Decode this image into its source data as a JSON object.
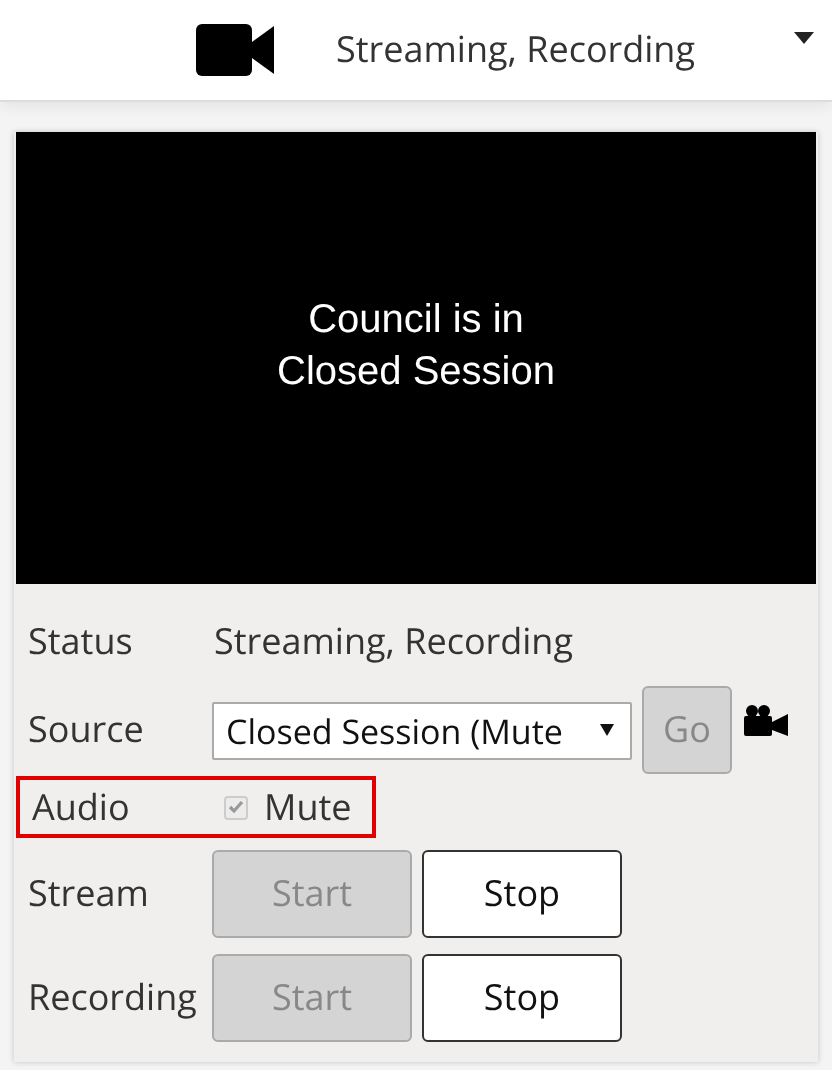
{
  "header": {
    "status": "Streaming, Recording"
  },
  "video": {
    "lines": [
      "Council is in",
      "Closed Session"
    ]
  },
  "controls": {
    "status": {
      "label": "Status",
      "value": "Streaming, Recording"
    },
    "source": {
      "label": "Source",
      "value": "Closed Session (Mute",
      "go": {
        "label": "Go",
        "disabled": true
      }
    },
    "audio": {
      "label": "Audio",
      "highlighted": true,
      "mute": {
        "label": "Mute",
        "checked": true,
        "disabled": true
      }
    },
    "actions": [
      {
        "label": "Stream",
        "buttons": [
          {
            "label": "Start",
            "disabled": true
          },
          {
            "label": "Stop",
            "disabled": false
          }
        ]
      },
      {
        "label": "Recording",
        "buttons": [
          {
            "label": "Start",
            "disabled": true
          },
          {
            "label": "Stop",
            "disabled": false
          }
        ]
      }
    ]
  }
}
